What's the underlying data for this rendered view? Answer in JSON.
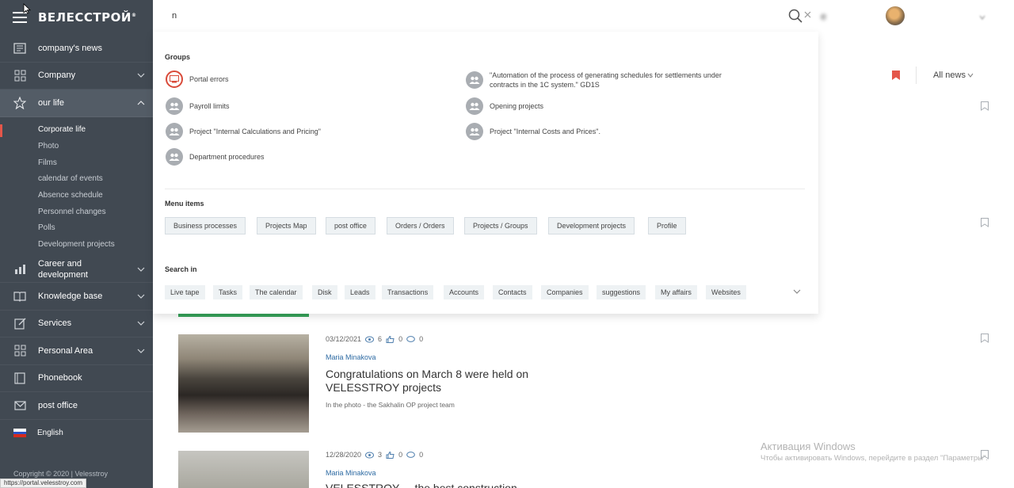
{
  "brand": {
    "logo": "ВЕЛЕССТРОЙ",
    "logo_mark": "®"
  },
  "sidebar": {
    "items": [
      {
        "label": "company's news",
        "icon": "news-icon",
        "expandable": false
      },
      {
        "label": "Company",
        "icon": "grid-icon",
        "expandable": true
      },
      {
        "label": "our life",
        "icon": "star-icon",
        "expandable": true,
        "expanded": true
      }
    ],
    "submenu": [
      "Corporate life",
      "Photo",
      "Films",
      "calendar of events",
      "Absence schedule",
      "Personnel changes",
      "Polls",
      "Development projects"
    ],
    "items_after": [
      {
        "label": "Career and development",
        "line1": "Career and",
        "line2": "development",
        "icon": "chart-icon",
        "expandable": true
      },
      {
        "label": "Knowledge base",
        "icon": "book-icon",
        "expandable": true
      },
      {
        "label": "Services",
        "icon": "edit-icon",
        "expandable": true
      },
      {
        "label": "Personal Area",
        "icon": "grid-icon",
        "expandable": true
      },
      {
        "label": "Phonebook",
        "icon": "phonebook-icon",
        "expandable": false
      },
      {
        "label": "post office",
        "icon": "mail-icon",
        "expandable": false
      }
    ],
    "language": "English",
    "copyright": "Copyright © 2020 | Velesstroy",
    "status_url": "https://portal.velesstroy.com"
  },
  "search": {
    "query": "n",
    "groups_title": "Groups",
    "groups": [
      {
        "label": "Portal errors",
        "icon": "portal-errors-icon"
      },
      {
        "label": "Payroll limits",
        "icon": "group-icon"
      },
      {
        "label": "Project \"Internal Calculations and Pricing\"",
        "icon": "group-icon"
      },
      {
        "label": "Department procedures",
        "icon": "group-icon"
      },
      {
        "label": "\"Automation of the process of generating schedules for settlements under contracts in the 1C system.\" GD1S",
        "line1": "\"Automation of the process of generating schedules for settlements under",
        "line2": "contracts in the 1C system.\" GD1S",
        "icon": "group-icon"
      },
      {
        "label": "Opening projects",
        "icon": "group-icon"
      },
      {
        "label": "Project \"Internal Costs and Prices\".",
        "icon": "group-icon"
      }
    ],
    "menu_title": "Menu items",
    "menu_items": [
      "Business processes",
      "Projects Map",
      "post office",
      "Orders / Orders",
      "Projects / Groups",
      "Development projects",
      "Profile"
    ],
    "search_in_title": "Search in",
    "search_in": [
      "Live tape",
      "Tasks",
      "The calendar",
      "Disk",
      "Leads",
      "Transactions",
      "Accounts",
      "Contacts",
      "Companies",
      "suggestions",
      "My affairs",
      "Websites"
    ]
  },
  "feed": {
    "filter_label": "All news",
    "posts": [
      {
        "date": "03/12/2021",
        "views": "6",
        "likes": "0",
        "comments": "0",
        "author": "Maria Minakova",
        "title": "Congratulations on March 8 were held on VELESSTROY projects",
        "subtitle": "In the photo - the Sakhalin OP project team"
      },
      {
        "date": "12/28/2020",
        "views": "3",
        "likes": "0",
        "comments": "0",
        "author": "Maria Minakova",
        "title": "VELESSTROY ... the best construction"
      }
    ]
  },
  "watermark": {
    "title": "Активация Windows",
    "subtitle": "Чтобы активировать Windows, перейдите в раздел \"Параметры\"."
  },
  "colors": {
    "sidebar_bg": "#414952",
    "accent_red": "#e4564a",
    "link_blue": "#2d6aa3"
  }
}
